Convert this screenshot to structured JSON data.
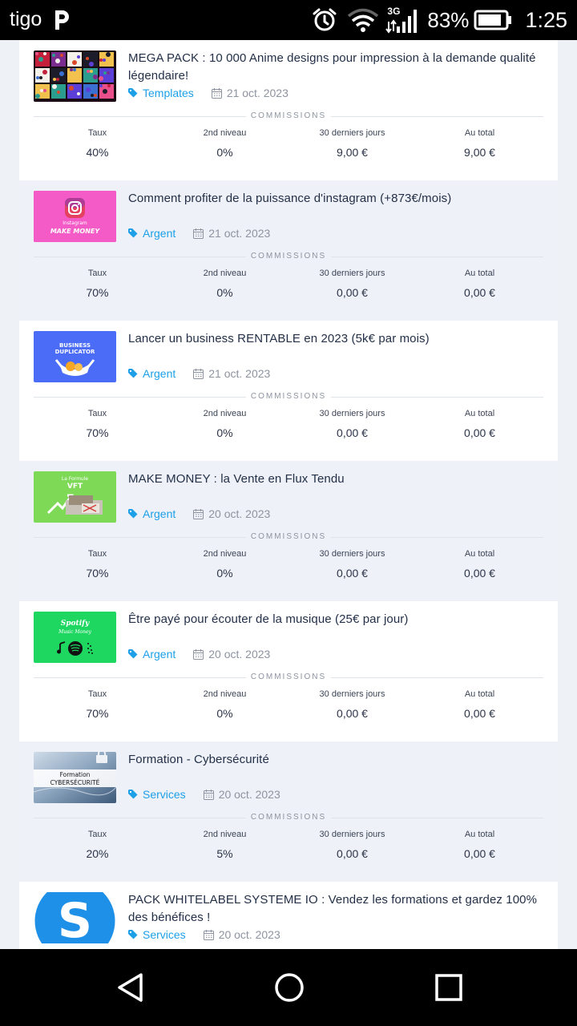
{
  "status_bar": {
    "carrier": "tigo",
    "network": "3G",
    "battery_percent": "83%",
    "time": "1:25"
  },
  "commissions_label": "COMMISSIONS",
  "stat_labels": [
    "Taux",
    "2nd niveau",
    "30 derniers jours",
    "Au total"
  ],
  "products": [
    {
      "title": "MEGA PACK : 10 000 Anime designs pour impression à la demande qualité légendaire!",
      "category": "Templates",
      "date": "21 oct. 2023",
      "taux": "40%",
      "second_level": "0%",
      "last_30_days": "9,00 €",
      "total": "9,00 €",
      "thumb": "anime-collage"
    },
    {
      "title": "Comment profiter de la puissance d'instagram (+873€/mois)",
      "category": "Argent",
      "date": "21 oct. 2023",
      "taux": "70%",
      "second_level": "0%",
      "last_30_days": "0,00 €",
      "total": "0,00 €",
      "thumb": "instagram",
      "thumb_text": [
        "Instagram",
        "MAKE MONEY"
      ]
    },
    {
      "title": "Lancer un business RENTABLE en 2023 (5k€ par mois)",
      "category": "Argent",
      "date": "21 oct. 2023",
      "taux": "70%",
      "second_level": "0%",
      "last_30_days": "0,00 €",
      "total": "0,00 €",
      "thumb": "business",
      "thumb_text": [
        "BUSINESS",
        "DUPLICATOR"
      ]
    },
    {
      "title": "MAKE MONEY : la Vente en Flux Tendu",
      "category": "Argent",
      "date": "20 oct. 2023",
      "taux": "70%",
      "second_level": "0%",
      "last_30_days": "0,00 €",
      "total": "0,00 €",
      "thumb": "vft",
      "thumb_text": [
        "La Formule",
        "VFT"
      ]
    },
    {
      "title": "Être payé pour écouter de la musique (25€ par jour)",
      "category": "Argent",
      "date": "20 oct. 2023",
      "taux": "70%",
      "second_level": "0%",
      "last_30_days": "0,00 €",
      "total": "0,00 €",
      "thumb": "spotify",
      "thumb_text": [
        "Spotify",
        "Music Money"
      ]
    },
    {
      "title": "Formation - Cybersécurité",
      "category": "Services",
      "date": "20 oct. 2023",
      "taux": "20%",
      "second_level": "5%",
      "last_30_days": "0,00 €",
      "total": "0,00 €",
      "thumb": "cyber",
      "thumb_text": [
        "Formation",
        "CYBERSÉCURITÉ"
      ]
    },
    {
      "title": "PACK WHITELABEL SYSTEME IO : Vendez les formations et gardez 100% des bénéfices !",
      "category": "Services",
      "date": "20 oct. 2023",
      "thumb": "systemeio",
      "thumb_text": [
        "S"
      ]
    }
  ],
  "colors": {
    "accent": "#1da0e8",
    "title": "#233048",
    "muted": "#8d93a0",
    "card_alt_bg": "#eef1f7"
  }
}
